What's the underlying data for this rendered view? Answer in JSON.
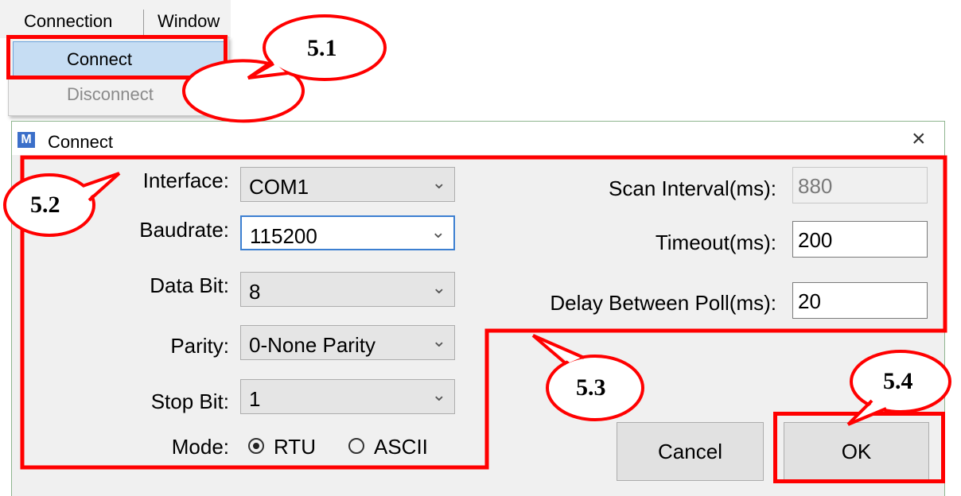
{
  "menu": {
    "connection": "Connection",
    "window": "Window",
    "items": {
      "connect": "Connect",
      "disconnect": "Disconnect"
    }
  },
  "dialog": {
    "title": "Connect",
    "icon_letter": "M",
    "interface": {
      "label": "Interface:",
      "value": "COM1"
    },
    "baudrate": {
      "label": "Baudrate:",
      "value": "115200"
    },
    "databit": {
      "label": "Data Bit:",
      "value": "8"
    },
    "parity": {
      "label": "Parity:",
      "value": "0-None Parity"
    },
    "stopbit": {
      "label": "Stop Bit:",
      "value": "1"
    },
    "mode": {
      "label": "Mode:",
      "options": [
        "RTU",
        "ASCII"
      ],
      "selected": "RTU"
    },
    "scan_interval": {
      "label": "Scan Interval(ms):",
      "value": "880"
    },
    "timeout": {
      "label": "Timeout(ms):",
      "value": "200"
    },
    "delay": {
      "label": "Delay Between Poll(ms):",
      "value": "20"
    },
    "buttons": {
      "cancel": "Cancel",
      "ok": "OK"
    }
  },
  "annotations": {
    "a1": "5.1",
    "a2": "5.2",
    "a3": "5.3",
    "a4": "5.4"
  },
  "colors": {
    "annotation": "#ff0000",
    "focus": "#3c7fd1",
    "menu_highlight": "#c6ddf3"
  }
}
